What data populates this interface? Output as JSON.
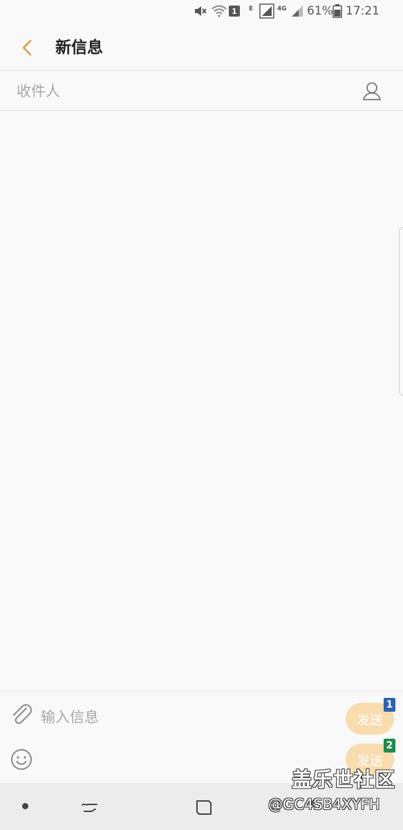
{
  "status_bar": {
    "sim_label": "1",
    "network_e": "E",
    "network_4g": "4G",
    "battery_percent": "61%",
    "time": "17:21"
  },
  "header": {
    "title": "新信息"
  },
  "recipient": {
    "placeholder": "收件人",
    "value": ""
  },
  "composer": {
    "placeholder": "输入信息",
    "value": "",
    "send_buttons": [
      {
        "label": "发送",
        "sim": "1",
        "sim_color": "#2d62b5"
      },
      {
        "label": "发送",
        "sim": "2",
        "sim_color": "#1f8a4c"
      }
    ]
  },
  "colors": {
    "accent": "#e0953a",
    "send_button_disabled": "#f8dcad"
  },
  "watermark": {
    "main": "盖乐世社区",
    "sub": "@GC4SB4XYFH"
  },
  "icons": [
    "mute-icon",
    "wifi-icon",
    "sim-icon",
    "signal-icon",
    "battery-icon",
    "back-arrow-icon",
    "contact-icon",
    "paperclip-icon",
    "emoji-icon",
    "recents-icon",
    "home-icon",
    "nav-back-icon"
  ]
}
